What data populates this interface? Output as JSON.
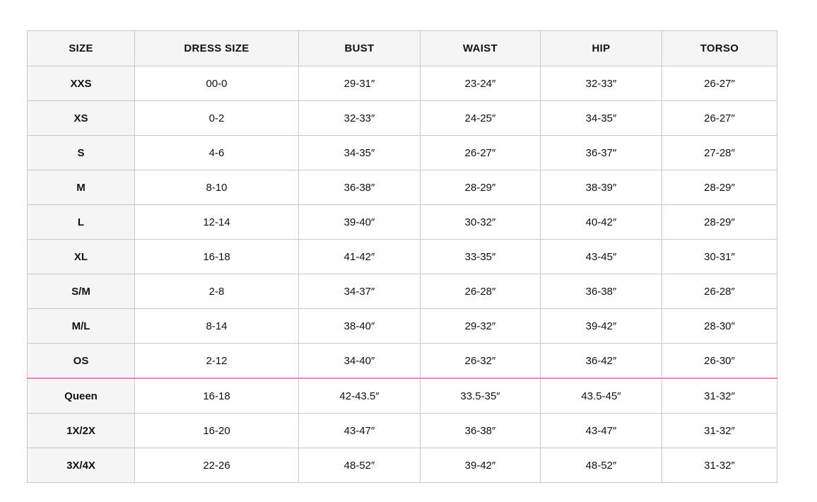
{
  "columns": [
    "SIZE",
    "DRESS SIZE",
    "BUST",
    "WAIST",
    "HIP",
    "TORSO"
  ],
  "colors": {
    "header_background": "#f5f5f5",
    "border": "#c9c9c9",
    "divider_accent": "#f07fc8"
  },
  "rows": [
    {
      "size": "XXS",
      "dress_size": "00-0",
      "bust": "29-31″",
      "waist": "23-24″",
      "hip": "32-33″",
      "torso": "26-27″"
    },
    {
      "size": "XS",
      "dress_size": "0-2",
      "bust": "32-33″",
      "waist": "24-25″",
      "hip": "34-35″",
      "torso": "26-27″"
    },
    {
      "size": "S",
      "dress_size": "4-6",
      "bust": "34-35″",
      "waist": "26-27″",
      "hip": "36-37″",
      "torso": "27-28″"
    },
    {
      "size": "M",
      "dress_size": "8-10",
      "bust": "36-38″",
      "waist": "28-29″",
      "hip": "38-39″",
      "torso": "28-29″"
    },
    {
      "size": "L",
      "dress_size": "12-14",
      "bust": "39-40″",
      "waist": "30-32″",
      "hip": "40-42″",
      "torso": "28-29″"
    },
    {
      "size": "XL",
      "dress_size": "16-18",
      "bust": "41-42″",
      "waist": "33-35″",
      "hip": "43-45″",
      "torso": "30-31″"
    },
    {
      "size": "S/M",
      "dress_size": "2-8",
      "bust": "34-37″",
      "waist": "26-28″",
      "hip": "36-38″",
      "torso": "26-28″"
    },
    {
      "size": "M/L",
      "dress_size": "8-14",
      "bust": "38-40″",
      "waist": "29-32″",
      "hip": "39-42″",
      "torso": "28-30″"
    },
    {
      "size": "OS",
      "dress_size": "2-12",
      "bust": "34-40″",
      "waist": "26-32″",
      "hip": "36-42″",
      "torso": "26-30″"
    },
    {
      "size": "Queen",
      "dress_size": "16-18",
      "bust": "42-43.5″",
      "waist": "33.5-35″",
      "hip": "43.5-45″",
      "torso": "31-32″"
    },
    {
      "size": "1X/2X",
      "dress_size": "16-20",
      "bust": "43-47″",
      "waist": "36-38″",
      "hip": "43-47″",
      "torso": "31-32″"
    },
    {
      "size": "3X/4X",
      "dress_size": "22-26",
      "bust": "48-52″",
      "waist": "39-42″",
      "hip": "48-52″",
      "torso": "31-32″"
    }
  ]
}
